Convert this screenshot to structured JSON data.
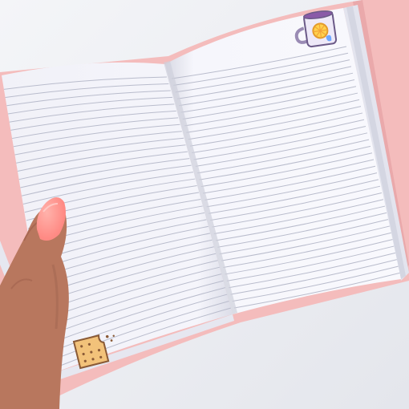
{
  "scene": {
    "background": "#eceef2",
    "cover_color": "#f4bcbc",
    "page_color": "#f7f7fd",
    "rule_color": "#b9bccc",
    "nail_color": "#ff8c86",
    "skin_color": "#b9785e"
  },
  "icons": {
    "mug": "tea-mug-with-lemon-icon",
    "cookie": "bitten-cracker-icon"
  }
}
